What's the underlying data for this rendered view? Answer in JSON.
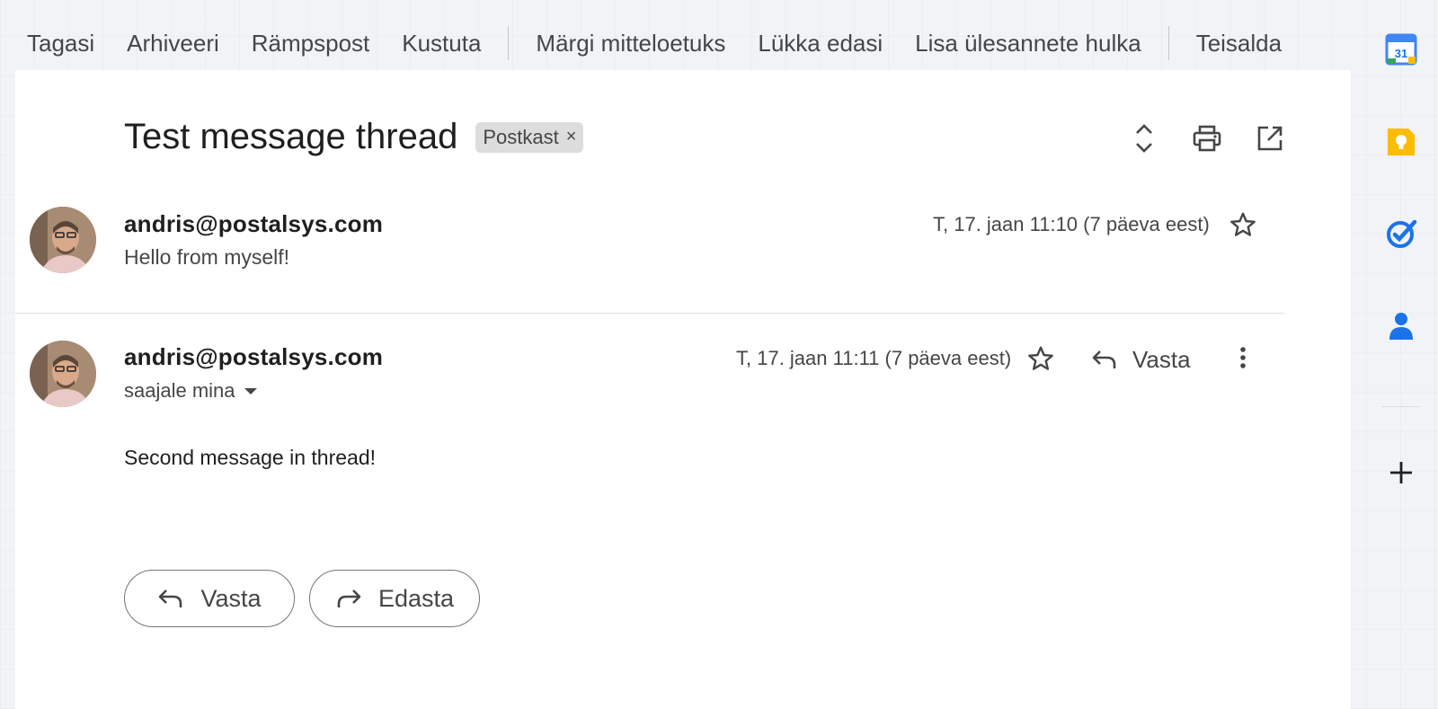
{
  "toolbar": {
    "back": "Tagasi",
    "archive": "Arhiveeri",
    "spam": "Rämpspost",
    "delete": "Kustuta",
    "mark_unread": "Märgi mitteloetuks",
    "snooze": "Lükka edasi",
    "add_task": "Lisa ülesannete hulka",
    "move": "Teisalda"
  },
  "thread": {
    "subject": "Test message thread",
    "label": "Postkast",
    "label_remove": "×"
  },
  "messages": [
    {
      "sender": "andris@postalsys.com",
      "snippet": "Hello from myself!",
      "date": "T, 17. jaan 11:10 (7 päeva eest)"
    },
    {
      "sender": "andris@postalsys.com",
      "to": "saajale mina",
      "date": "T, 17. jaan 11:11 (7 päeva eest)",
      "reply_label": "Vasta",
      "body": "Second message in thread!"
    }
  ],
  "actions": {
    "reply": "Vasta",
    "forward": "Edasta"
  },
  "side_panel": {
    "calendar_day": "31",
    "icons": [
      "calendar-icon",
      "keep-icon",
      "tasks-icon",
      "contacts-icon",
      "add-icon"
    ]
  },
  "colors": {
    "calendar_blue": "#4285f4",
    "keep_yellow": "#fbbc04",
    "tasks_blue": "#1a73e8",
    "contacts_blue": "#1a73e8"
  }
}
